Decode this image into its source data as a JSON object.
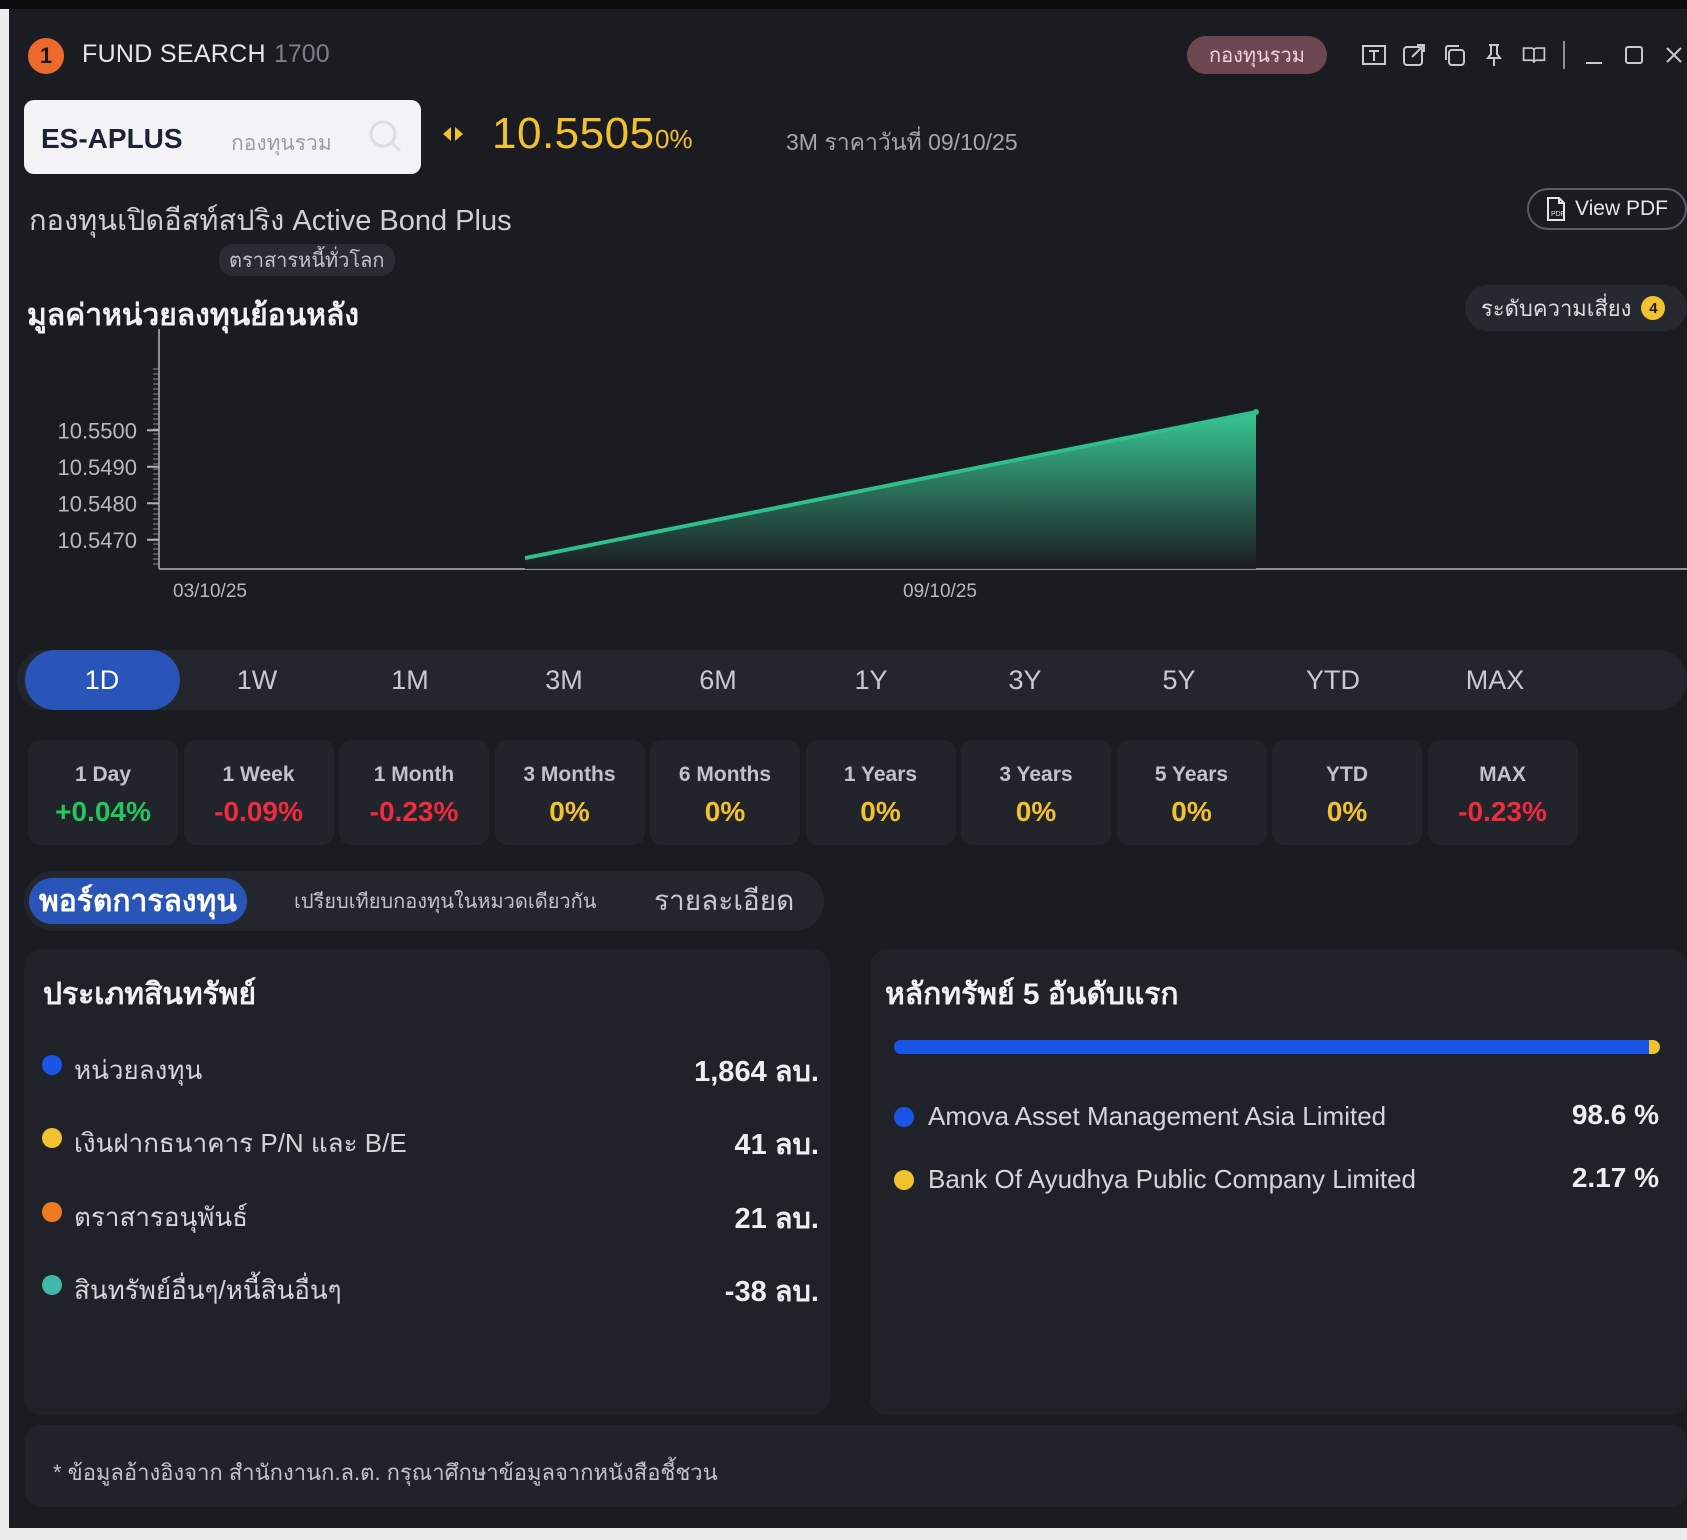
{
  "window": {
    "badge": "1",
    "title": "FUND SEARCH",
    "code": "1700",
    "fund_type_pill": "กองทุนรวม"
  },
  "search": {
    "symbol": "ES-APLUS",
    "category": "กองทุนรวม"
  },
  "quote": {
    "price": "10.5505",
    "change": "0%",
    "date_label": "3M ราคาวันที่ 09/10/25"
  },
  "fund": {
    "name": "กองทุนเปิดอีสท์สปริง Active Bond Plus",
    "category_tag": "ตราสารหนี้ทั่วโลก",
    "view_pdf": "View PDF"
  },
  "chart_section": {
    "title": "มูลค่าหน่วยลงทุนย้อนหลัง",
    "risk_label": "ระดับความเสี่ยง",
    "risk_level": "4"
  },
  "chart_data": {
    "type": "area",
    "x": [
      "03/10/25",
      "09/10/25"
    ],
    "y": [
      10.5465,
      10.5505
    ],
    "xticks": [
      "03/10/25",
      "09/10/25"
    ],
    "yticks": [
      "10.5500",
      "10.5490",
      "10.5480",
      "10.5470"
    ],
    "ylim": [
      10.5462,
      10.5525
    ],
    "color": "#2fbf8a",
    "grid": false
  },
  "period_tabs": [
    "1D",
    "1W",
    "1M",
    "3M",
    "6M",
    "1Y",
    "3Y",
    "5Y",
    "YTD",
    "MAX"
  ],
  "active_period": "1D",
  "performance": [
    {
      "label": "1 Day",
      "value": "+0.04%",
      "color": "#22c55e"
    },
    {
      "label": "1 Week",
      "value": "-0.09%",
      "color": "#ef2b40"
    },
    {
      "label": "1 Month",
      "value": "-0.23%",
      "color": "#ef2b40"
    },
    {
      "label": "3 Months",
      "value": "0%",
      "color": "#f2c12e"
    },
    {
      "label": "6 Months",
      "value": "0%",
      "color": "#f2c12e"
    },
    {
      "label": "1 Years",
      "value": "0%",
      "color": "#f2c12e"
    },
    {
      "label": "3 Years",
      "value": "0%",
      "color": "#f2c12e"
    },
    {
      "label": "5 Years",
      "value": "0%",
      "color": "#f2c12e"
    },
    {
      "label": "YTD",
      "value": "0%",
      "color": "#f2c12e"
    },
    {
      "label": "MAX",
      "value": "-0.23%",
      "color": "#ef2b40"
    }
  ],
  "sub_tabs": [
    "พอร์ตการลงทุน",
    "เปรียบเทียบกองทุนในหมวดเดียวกัน",
    "รายละเอียด"
  ],
  "asset_panel": {
    "title": "ประเภทสินทรัพย์",
    "items": [
      {
        "name": "หน่วยลงทุน",
        "value": "1,864 ลบ.",
        "color": "#1a55e8"
      },
      {
        "name": "เงินฝากธนาคาร P/N และ B/E",
        "value": "41 ลบ.",
        "color": "#f2c12e"
      },
      {
        "name": "ตราสารอนุพันธ์",
        "value": "21 ลบ.",
        "color": "#f07a22"
      },
      {
        "name": "สินทรัพย์อื่นๆ/หนี้สินอื่นๆ",
        "value": "-38 ลบ.",
        "color": "#3fb8a8"
      }
    ]
  },
  "holdings_panel": {
    "title": "หลักทรัพย์ 5 อันดับแรก",
    "bar_split_percent": 98.6,
    "items": [
      {
        "name": "Amova Asset Management Asia Limited",
        "value": "98.6 %",
        "color": "#1a55e8"
      },
      {
        "name": "Bank Of Ayudhya Public Company Limited",
        "value": "2.17 %",
        "color": "#f2c12e"
      }
    ]
  },
  "footnote": "* ข้อมูลอ้างอิงจาก สำนักงานก.ล.ต. กรุณาศึกษาข้อมูลจากหนังสือชี้ชวน"
}
